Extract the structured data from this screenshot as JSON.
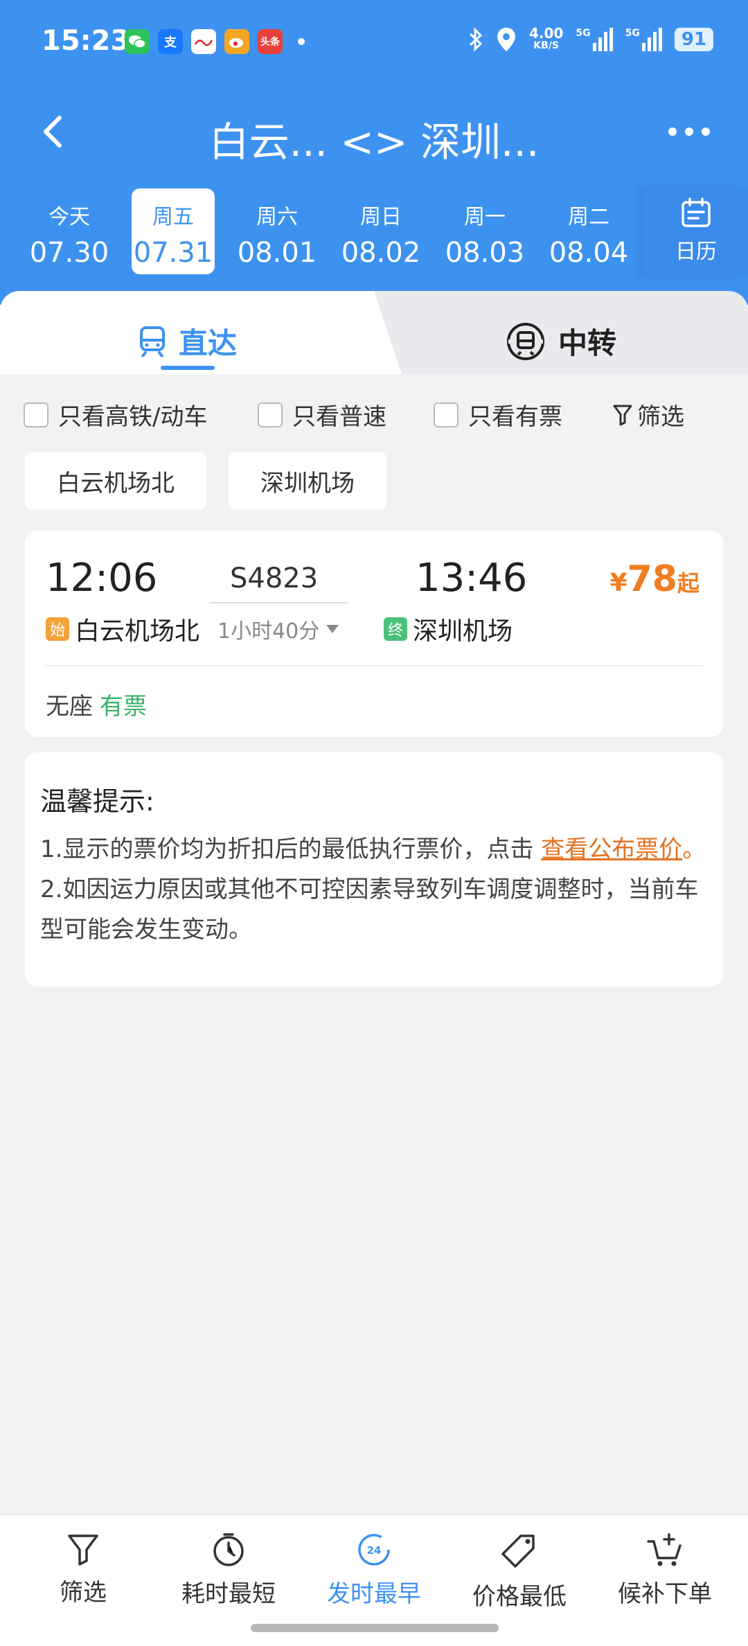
{
  "status_bar": {
    "time": "15:23",
    "network_speed": "4.00",
    "speed_unit": "KB/S",
    "signal_1": "5G",
    "signal_2": "5G",
    "battery": "91",
    "apps": [
      "wechat-icon",
      "alipay-icon",
      "people-daily-icon",
      "weibo-icon",
      "toutiao-icon"
    ],
    "app_labels": {
      "alipay": "支",
      "toutiao": "头条"
    }
  },
  "header": {
    "title": "白云... <> 深圳..."
  },
  "dates": [
    {
      "weekday": "今天",
      "date": "07.30"
    },
    {
      "weekday": "周五",
      "date": "07.31",
      "active": true
    },
    {
      "weekday": "周六",
      "date": "08.01"
    },
    {
      "weekday": "周日",
      "date": "08.02"
    },
    {
      "weekday": "周一",
      "date": "08.03"
    },
    {
      "weekday": "周二",
      "date": "08.04"
    }
  ],
  "calendar_label": "日历",
  "tabs": {
    "direct": "直达",
    "transfer": "中转"
  },
  "filters": {
    "high_speed": "只看高铁/动车",
    "normal": "只看普速",
    "available": "只看有票",
    "filter_label": "筛选"
  },
  "stations": [
    "白云机场北",
    "深圳机场"
  ],
  "train": {
    "depart_time": "12:06",
    "arrive_time": "13:46",
    "number": "S4823",
    "duration": "1小时40分",
    "start_tag": "始",
    "end_tag": "终",
    "from_station": "白云机场北",
    "to_station": "深圳机场",
    "price_currency": "¥",
    "price": "78",
    "price_suffix": "起",
    "seat_type": "无座",
    "seat_status": "有票"
  },
  "tips": {
    "title": "温馨提示:",
    "line1_text": "1.显示的票价均为折扣后的最低执行票价，点击 ",
    "line1_link": "查看公布票价",
    "line1_end": "。",
    "line2": "2.如因运力原因或其他不可控因素导致列车调度调整时，当前车",
    "line3": "型可能会发生变动。"
  },
  "bottom_bar": {
    "filter": "筛选",
    "shortest": "耗时最短",
    "earliest": "发时最早",
    "cheapest": "价格最低",
    "waitlist": "候补下单",
    "clock_label": "24"
  },
  "colors": {
    "primary": "#3d92f0",
    "price": "#ef7d22",
    "available": "#3bb06a"
  }
}
